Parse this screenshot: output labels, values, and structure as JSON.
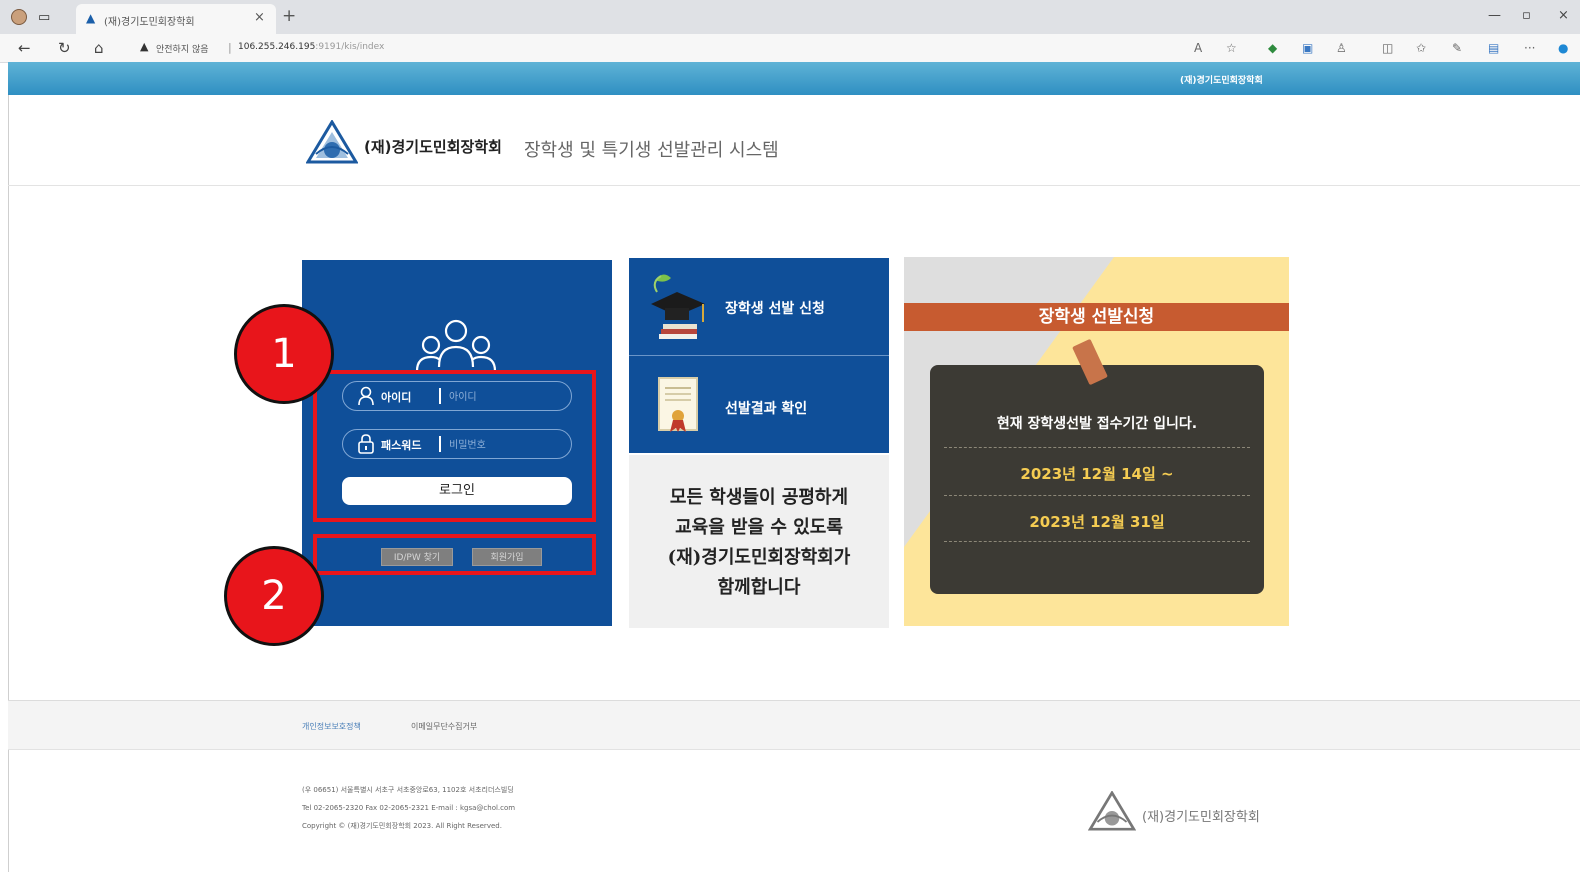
{
  "browser": {
    "tab_title": "(재)경기도민회장학회",
    "security_label": "안전하지 않음",
    "url_host": "106.255.246.195",
    "url_rest": ":9191/kis/index"
  },
  "site": {
    "gnb_org": "(재)경기도민회장학회",
    "org_name": "(재)경기도민회장학회",
    "system_name": "장학생 및 특기생 선발관리 시스템"
  },
  "login": {
    "id_label": "아이디",
    "id_placeholder": "아이디",
    "pw_label": "패스워드",
    "pw_placeholder": "비밀번호",
    "login_button": "로그인",
    "find_button": "ID/PW 찾기",
    "join_button": "회원가입"
  },
  "menu": {
    "apply": "장학생 선발 신청",
    "result": "선발결과 확인",
    "slogan": [
      "모든 학생들이 공평하게",
      "교육을 받을 수 있도록",
      "(재)경기도민회장학회가",
      "함께합니다"
    ]
  },
  "notice": {
    "title": "장학생 선발신청",
    "line1": "현재 장학생선발 접수기간 입니다.",
    "line2": "2023년 12월 14일 ~",
    "line3": "2023년 12월 31일"
  },
  "footer": {
    "privacy": "개인정보보호정책",
    "email_refuse": "이메일무단수집거부",
    "address": "(우 06651) 서울특별시 서초구 서초중앙로63, 1102호 서초리더스빌딩",
    "contact": "Tel 02-2065-2320 Fax 02-2065-2321 E-mail : kgsa@chol.com",
    "copyright": "Copyright © (재)경기도민회장학회 2023. All Right Reserved.",
    "logo_name": "(재)경기도민회장학회"
  },
  "annotations": {
    "marker1": "1",
    "marker2": "2"
  },
  "colors": {
    "navy": "#0f4f99",
    "annotation_red": "#e8151b",
    "notice_yellow": "#fde59a",
    "notice_orange": "#c75b30"
  }
}
